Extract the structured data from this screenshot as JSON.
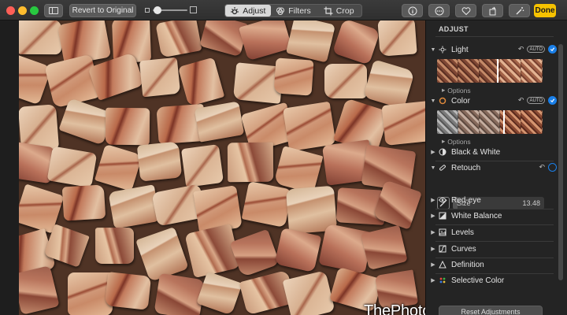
{
  "toolbar": {
    "revert_label": "Revert to Original",
    "tabs": [
      {
        "label": "Adjust",
        "icon": "sun-icon",
        "active": true
      },
      {
        "label": "Filters",
        "icon": "filters-icon",
        "active": false
      },
      {
        "label": "Crop",
        "icon": "crop-icon",
        "active": false
      }
    ],
    "done_label": "Done",
    "accent_color": "#f6c200"
  },
  "photo": {
    "watermark": "ThePhotoOrganizers.com"
  },
  "panel": {
    "title": "ADJUST",
    "sections": {
      "light": {
        "label": "Light",
        "auto": "AUTO",
        "options": "Options"
      },
      "color": {
        "label": "Color",
        "auto": "AUTO",
        "options": "Options"
      },
      "black_white": {
        "label": "Black & White"
      },
      "retouch": {
        "label": "Retouch",
        "size_label": "Size",
        "size_value": "13.48"
      },
      "red_eye": {
        "label": "Red-eye"
      },
      "white_balance": {
        "label": "White Balance"
      },
      "levels": {
        "label": "Levels"
      },
      "curves": {
        "label": "Curves"
      },
      "definition": {
        "label": "Definition"
      },
      "selective_color": {
        "label": "Selective Color"
      }
    },
    "reset_label": "Reset Adjustments",
    "check_color": "#1a7fe8"
  }
}
